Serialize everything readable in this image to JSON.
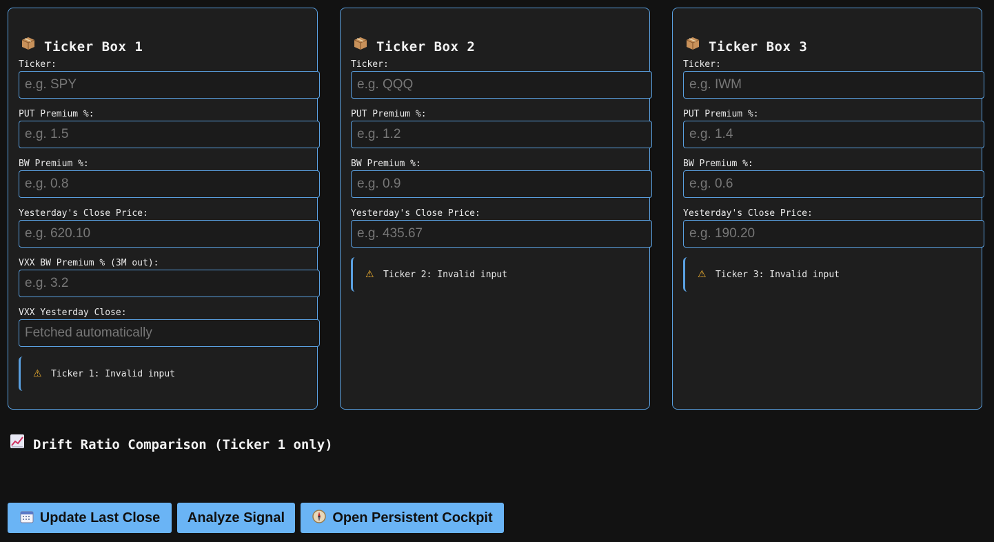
{
  "boxes": [
    {
      "icon": "package-icon",
      "title": "Ticker Box 1",
      "fields": [
        {
          "label": "Ticker:",
          "placeholder": "e.g. SPY"
        },
        {
          "label": "PUT Premium %:",
          "placeholder": "e.g. 1.5"
        },
        {
          "label": "BW Premium %:",
          "placeholder": "e.g. 0.8"
        },
        {
          "label": "Yesterday's Close Price:",
          "placeholder": "e.g. 620.10"
        },
        {
          "label": "VXX BW Premium % (3M out):",
          "placeholder": "e.g. 3.2"
        },
        {
          "label": "VXX Yesterday Close:",
          "placeholder": "Fetched automatically"
        }
      ],
      "warning": "Ticker 1: Invalid input"
    },
    {
      "icon": "package-icon",
      "title": "Ticker Box 2",
      "fields": [
        {
          "label": "Ticker:",
          "placeholder": "e.g. QQQ"
        },
        {
          "label": "PUT Premium %:",
          "placeholder": "e.g. 1.2"
        },
        {
          "label": "BW Premium %:",
          "placeholder": "e.g. 0.9"
        },
        {
          "label": "Yesterday's Close Price:",
          "placeholder": "e.g. 435.67"
        }
      ],
      "warning": "Ticker 2: Invalid input"
    },
    {
      "icon": "package-icon",
      "title": "Ticker Box 3",
      "fields": [
        {
          "label": "Ticker:",
          "placeholder": "e.g. IWM"
        },
        {
          "label": "PUT Premium %:",
          "placeholder": "e.g. 1.4"
        },
        {
          "label": "BW Premium %:",
          "placeholder": "e.g. 0.6"
        },
        {
          "label": "Yesterday's Close Price:",
          "placeholder": "e.g. 190.20"
        }
      ],
      "warning": "Ticker 3: Invalid input"
    }
  ],
  "drift_section": {
    "icon": "chart-increasing-icon",
    "title": "Drift Ratio Comparison (Ticker 1 only)"
  },
  "buttons": {
    "update_last_close": {
      "icon": "calendar-icon",
      "label": "Update Last Close"
    },
    "analyze_signal": {
      "label": "Analyze Signal"
    },
    "open_cockpit": {
      "icon": "compass-icon",
      "label": "Open Persistent Cockpit"
    }
  },
  "colors": {
    "background": "#121212",
    "panel": "#1e1e1e",
    "accent_border": "#5aa0e0",
    "button": "#6ab4f5",
    "warning_icon": "#f0b030"
  }
}
